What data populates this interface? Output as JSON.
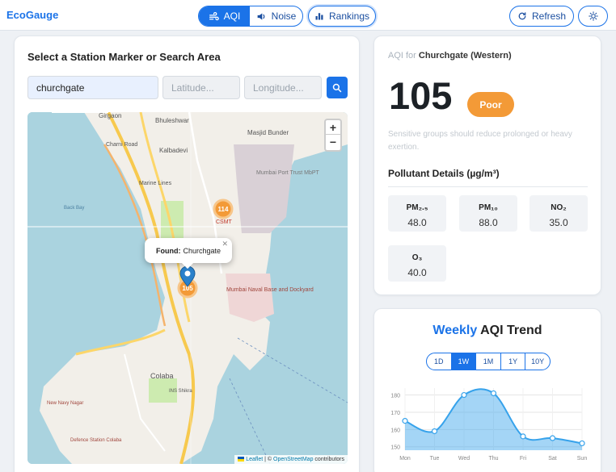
{
  "brand": "EcoGauge",
  "nav": {
    "aqi_label": "AQI",
    "noise_label": "Noise",
    "rankings_label": "Rankings",
    "refresh_label": "Refresh"
  },
  "left": {
    "title": "Select a Station Marker or Search Area",
    "search_value": "churchgate",
    "lat_placeholder": "Latitude...",
    "lng_placeholder": "Longitude...",
    "map": {
      "labels": [
        "Girgaon",
        "Bhuleshwar",
        "Masjid Bunder",
        "Charni Road",
        "Kalbadevi",
        "Mumbai Port Trust MbPT",
        "Marine Lines",
        "Back Bay",
        "CSMT",
        "Mumbai Naval Base and Dockyard",
        "Colaba",
        "INS Shikra",
        "New Navy Nagar",
        "Defence Station Colaba"
      ],
      "markers": [
        {
          "value": "114"
        },
        {
          "value": "105"
        }
      ],
      "popup_label": "Found:",
      "popup_value": "Churchgate",
      "zoom_in": "+",
      "zoom_out": "−",
      "attribution_leaflet": "Leaflet",
      "attribution_sep": "| ©",
      "attribution_osm": "OpenStreetMap",
      "attribution_tail": "contributors"
    }
  },
  "aqi": {
    "for_label": "AQI for",
    "station": "Churchgate (Western)",
    "value": "105",
    "status": "Poor",
    "status_color": "#f39a37",
    "description": "Sensitive groups should reduce prolonged or heavy exertion.",
    "pollutant_title": "Pollutant Details (µg/m³)",
    "pollutants": [
      {
        "name": "PM₂.₅",
        "value": "48.0"
      },
      {
        "name": "PM₁₀",
        "value": "88.0"
      },
      {
        "name": "NO₂",
        "value": "35.0"
      },
      {
        "name": "O₃",
        "value": "40.0"
      }
    ]
  },
  "trend": {
    "title_highlight": "Weekly",
    "title_rest": "AQI Trend",
    "ranges": [
      "1D",
      "1W",
      "1M",
      "1Y",
      "10Y"
    ],
    "active_range": "1W"
  },
  "chart_data": {
    "type": "area",
    "categories": [
      "Mon",
      "Tue",
      "Wed",
      "Thu",
      "Fri",
      "Sat",
      "Sun"
    ],
    "values": [
      165,
      159,
      180,
      181,
      156,
      155,
      152
    ],
    "ylim": [
      148,
      184
    ],
    "yticks": [
      150,
      160,
      170,
      180
    ],
    "grid": true,
    "color": "#36a2eb"
  }
}
